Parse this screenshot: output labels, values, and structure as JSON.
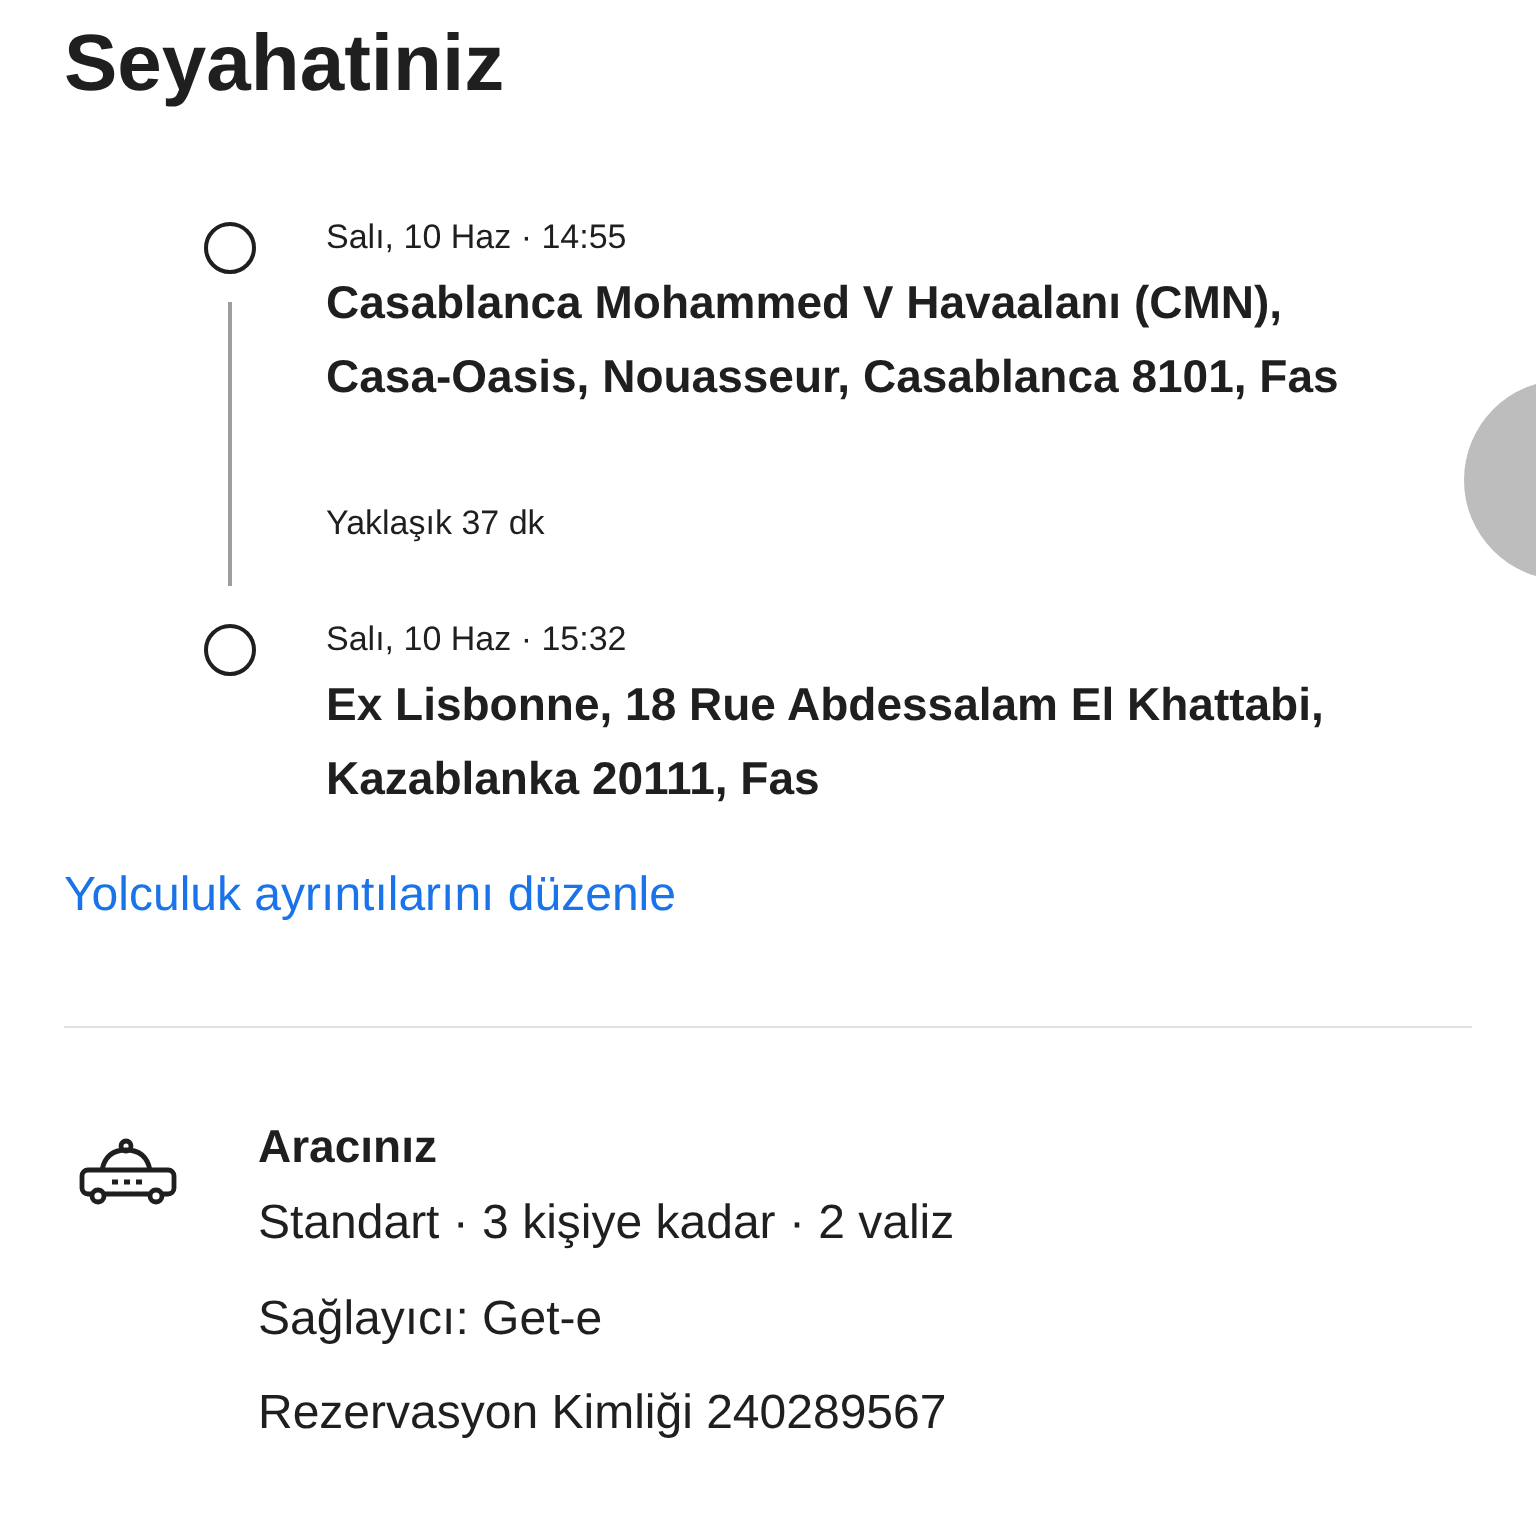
{
  "title": "Seyahatiniz",
  "stops": [
    {
      "time": "Salı, 10 Haz · 14:55",
      "address_lines": [
        "Casablanca Mohammed V Havaalanı (CMN),",
        "Casa-Oasis, Nouasseur, Casablanca 8101, Fas"
      ],
      "duration": "Yaklaşık 37 dk"
    },
    {
      "time": "Salı, 10 Haz · 15:32",
      "address_lines": [
        "Ex Lisbonne, 18 Rue Abdessalam El Khattabi,",
        "Kazablanka 20111, Fas"
      ]
    }
  ],
  "edit_link": "Yolculuk ayrıntılarını düzenle",
  "vehicle": {
    "title": "Aracınız",
    "details": [
      "Standart · 3 kişiye kadar · 2 valiz",
      "Sağlayıcı: Get-e",
      "Rezervasyon Kimliği 240289567"
    ]
  }
}
